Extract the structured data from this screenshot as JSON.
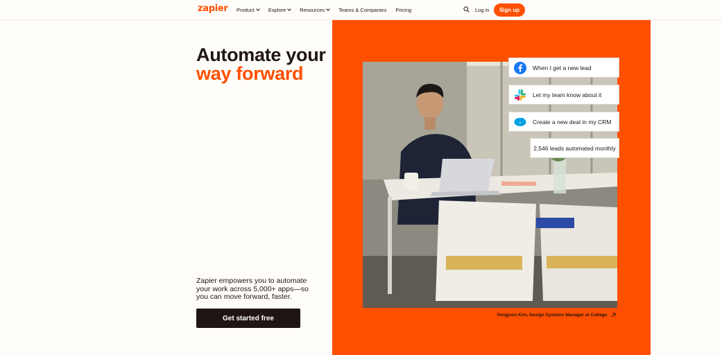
{
  "header": {
    "logo": "zapier",
    "nav": [
      {
        "label": "Product",
        "has_dropdown": true
      },
      {
        "label": "Explore",
        "has_dropdown": true
      },
      {
        "label": "Resources",
        "has_dropdown": true
      },
      {
        "label": "Teams & Companies",
        "has_dropdown": false
      },
      {
        "label": "Pricing",
        "has_dropdown": false
      }
    ],
    "search_icon": "search-icon",
    "login": "Log in",
    "signup": "Sign up"
  },
  "hero": {
    "title_line1": "Automate your",
    "title_line2": "way forward",
    "subtitle": "Zapier empowers you to automate your work across 5,000+ apps—so you can move forward, faster.",
    "cta": "Get started free"
  },
  "cards": [
    {
      "icon": "facebook-icon",
      "text": "When I get a new lead"
    },
    {
      "icon": "slack-icon",
      "text": "Let my team know about it"
    },
    {
      "icon": "salesforce-icon",
      "text": "Create a new deal in my CRM"
    },
    {
      "icon": "none",
      "text": "2,546 leads automated monthly"
    }
  ],
  "caption": "Yongjoon Kim, Design Systems Manager at Cottage",
  "colors": {
    "brand": "#ff4f00",
    "dark": "#201515",
    "background": "#fffdf9"
  }
}
